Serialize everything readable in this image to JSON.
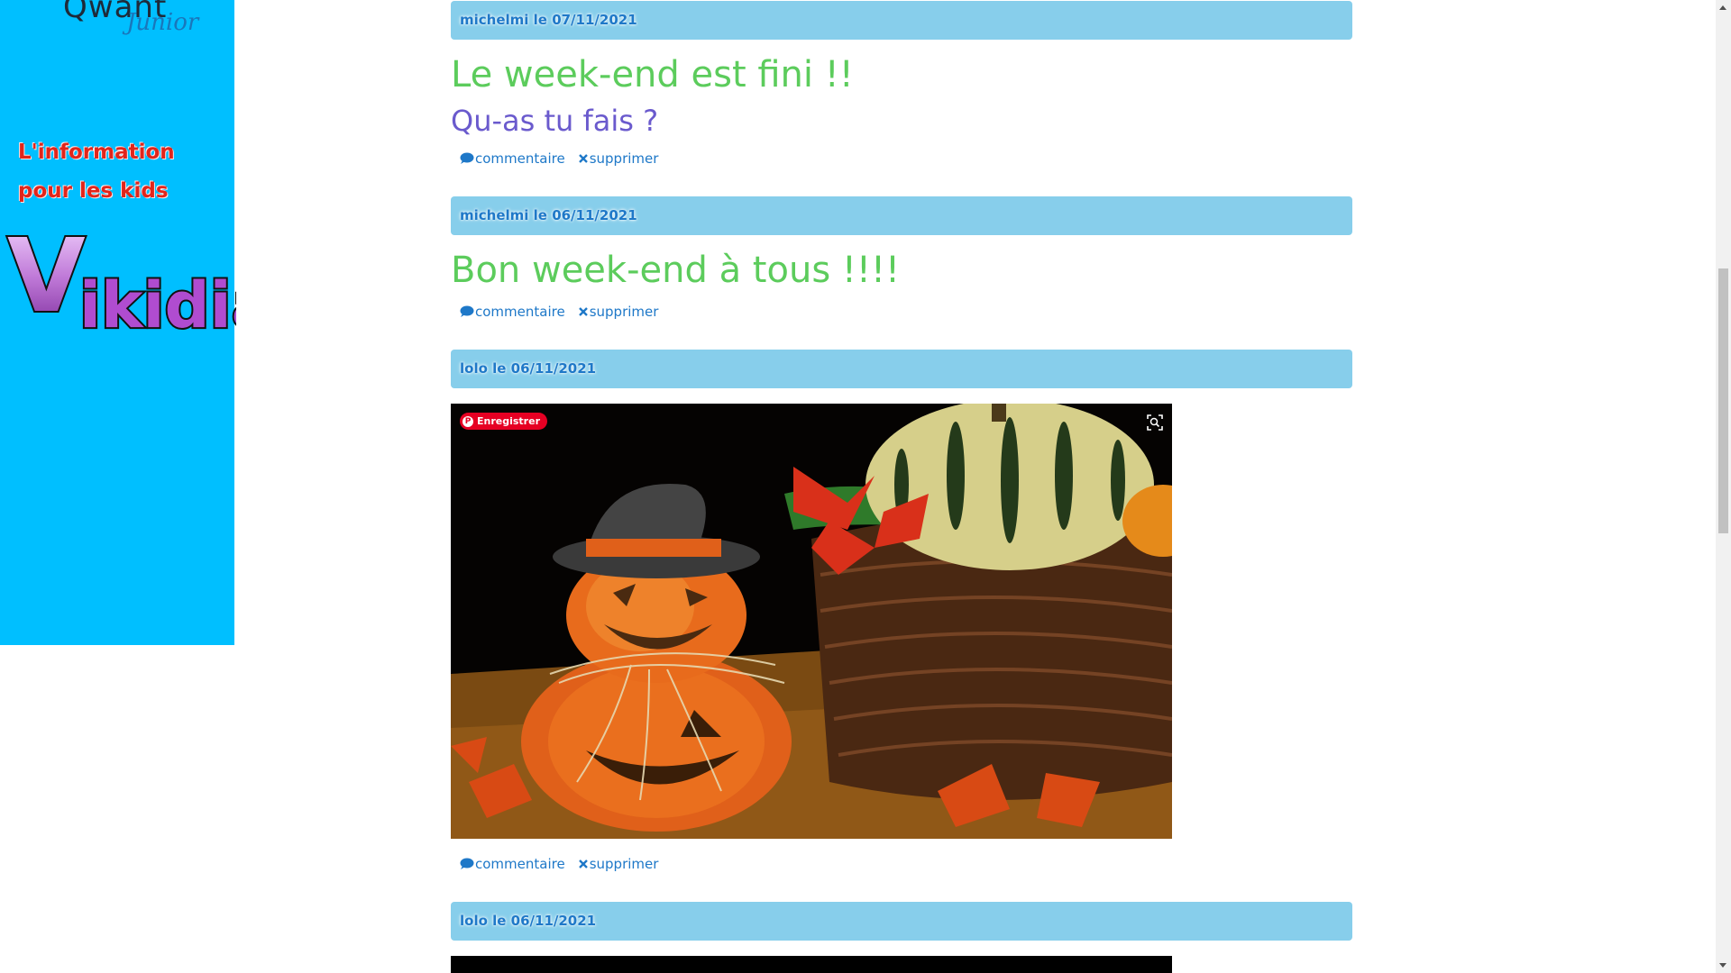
{
  "sidebar": {
    "qwant_logo_text": "Qwant",
    "qwant_junior_text": "Junior",
    "kids_info_text": "L'information pour les kids",
    "vikidia_logo_text": "Vikidia"
  },
  "posts": [
    {
      "header": "michelmi le 07/11/2021",
      "title": "Le week-end est fini !!",
      "subtitle": "Qu-as tu fais ?",
      "comment_label": "commentaire",
      "delete_label": "supprimer"
    },
    {
      "header": "michelmi le 06/11/2021",
      "title": "Bon week-end à tous !!!!",
      "comment_label": "commentaire",
      "delete_label": "supprimer"
    },
    {
      "header": "lolo le 06/11/2021",
      "image_pin_label": "Enregistrer",
      "comment_label": "commentaire",
      "delete_label": "supprimer"
    },
    {
      "header": "lolo le 06/11/2021"
    }
  ],
  "icons": {
    "comment": "comment-icon",
    "delete": "close-icon",
    "pinterest": "pinterest-icon",
    "visual_search": "visual-search-icon"
  },
  "colors": {
    "sidebar_bg": "#00bfff",
    "header_bg": "#87ceeb",
    "title_green": "#5ccc5c",
    "subtitle_purple": "#6a5acd",
    "link_blue": "#1e78c8",
    "kids_red": "#e1251b",
    "pinterest_red": "#e60023"
  }
}
